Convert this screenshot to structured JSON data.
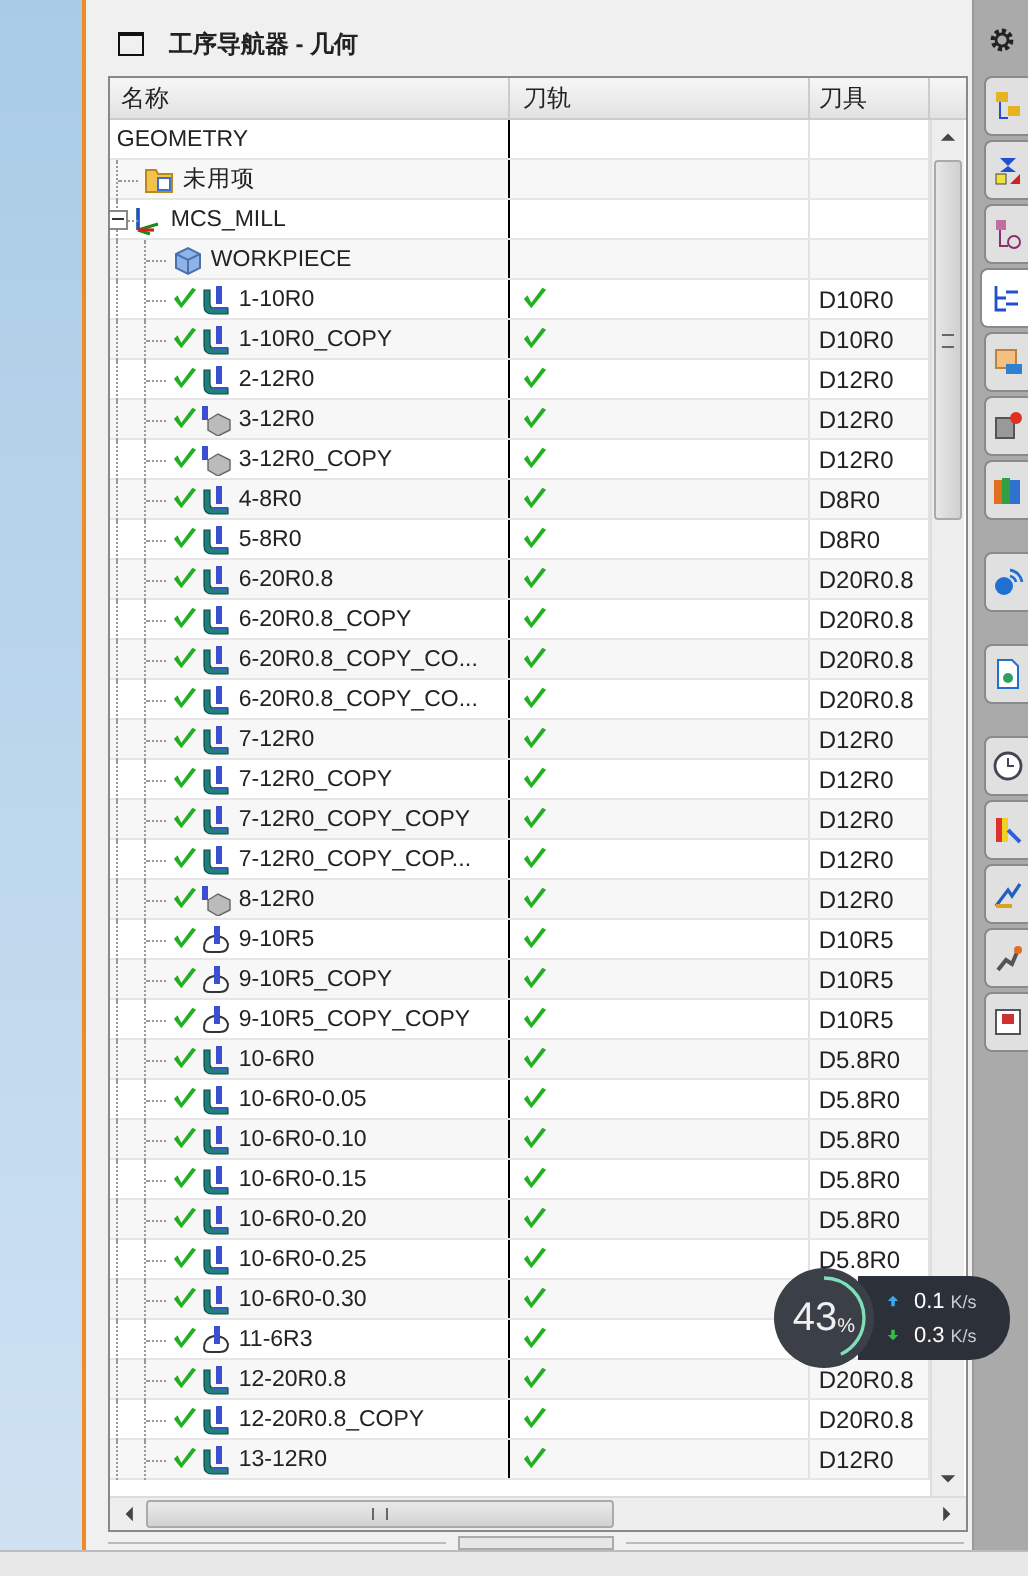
{
  "navigator": {
    "title": "工序导航器 - 几何",
    "columns": [
      "名称",
      "刀轨",
      "刀具"
    ],
    "tree": {
      "name": "GEOMETRY",
      "children": [
        {
          "name": "未用项",
          "kind": "folder"
        },
        {
          "name": "MCS_MILL",
          "kind": "mcs",
          "expanded": true,
          "children": [
            {
              "name": "WORKPIECE",
              "kind": "workpiece"
            },
            {
              "name": "1-10R0",
              "kind": "mill",
              "generated": true,
              "tool": "D10R0"
            },
            {
              "name": "1-10R0_COPY",
              "kind": "mill",
              "generated": true,
              "tool": "D10R0"
            },
            {
              "name": "2-12R0",
              "kind": "mill",
              "generated": true,
              "tool": "D12R0"
            },
            {
              "name": "3-12R0",
              "kind": "drill",
              "generated": true,
              "tool": "D12R0"
            },
            {
              "name": "3-12R0_COPY",
              "kind": "drill",
              "generated": true,
              "tool": "D12R0"
            },
            {
              "name": "4-8R0",
              "kind": "mill",
              "generated": true,
              "tool": "D8R0"
            },
            {
              "name": "5-8R0",
              "kind": "mill",
              "generated": true,
              "tool": "D8R0"
            },
            {
              "name": "6-20R0.8",
              "kind": "mill",
              "generated": true,
              "tool": "D20R0.8"
            },
            {
              "name": "6-20R0.8_COPY",
              "kind": "mill",
              "generated": true,
              "tool": "D20R0.8"
            },
            {
              "name": "6-20R0.8_COPY_CO...",
              "kind": "mill",
              "generated": true,
              "tool": "D20R0.8"
            },
            {
              "name": "6-20R0.8_COPY_CO...",
              "kind": "mill",
              "generated": true,
              "tool": "D20R0.8"
            },
            {
              "name": "7-12R0",
              "kind": "mill",
              "generated": true,
              "tool": "D12R0"
            },
            {
              "name": "7-12R0_COPY",
              "kind": "mill",
              "generated": true,
              "tool": "D12R0"
            },
            {
              "name": "7-12R0_COPY_COPY",
              "kind": "mill",
              "generated": true,
              "tool": "D12R0"
            },
            {
              "name": "7-12R0_COPY_COP...",
              "kind": "mill",
              "generated": true,
              "tool": "D12R0"
            },
            {
              "name": "8-12R0",
              "kind": "drill",
              "generated": true,
              "tool": "D12R0"
            },
            {
              "name": "9-10R5",
              "kind": "contour",
              "generated": true,
              "tool": "D10R5"
            },
            {
              "name": "9-10R5_COPY",
              "kind": "contour",
              "generated": true,
              "tool": "D10R5"
            },
            {
              "name": "9-10R5_COPY_COPY",
              "kind": "contour",
              "generated": true,
              "tool": "D10R5"
            },
            {
              "name": "10-6R0",
              "kind": "mill",
              "generated": true,
              "tool": "D5.8R0"
            },
            {
              "name": "10-6R0-0.05",
              "kind": "mill",
              "generated": true,
              "tool": "D5.8R0"
            },
            {
              "name": "10-6R0-0.10",
              "kind": "mill",
              "generated": true,
              "tool": "D5.8R0"
            },
            {
              "name": "10-6R0-0.15",
              "kind": "mill",
              "generated": true,
              "tool": "D5.8R0"
            },
            {
              "name": "10-6R0-0.20",
              "kind": "mill",
              "generated": true,
              "tool": "D5.8R0"
            },
            {
              "name": "10-6R0-0.25",
              "kind": "mill",
              "generated": true,
              "tool": "D5.8R0"
            },
            {
              "name": "10-6R0-0.30",
              "kind": "mill",
              "generated": true
            },
            {
              "name": "11-6R3",
              "kind": "contour",
              "generated": true
            },
            {
              "name": "12-20R0.8",
              "kind": "mill",
              "generated": true,
              "tool": "D20R0.8"
            },
            {
              "name": "12-20R0.8_COPY",
              "kind": "mill",
              "generated": true,
              "tool": "D20R0.8"
            },
            {
              "name": "13-12R0",
              "kind": "mill",
              "generated": true,
              "tool": "D12R0"
            }
          ]
        }
      ]
    }
  },
  "resource_bar": {
    "tabs": [
      {
        "selected": false
      },
      {
        "selected": false
      },
      {
        "selected": false
      },
      {
        "selected": true
      },
      {
        "selected": false
      },
      {
        "selected": false
      },
      {
        "selected": false
      },
      {
        "selected": false
      },
      {
        "selected": false
      },
      {
        "selected": false
      },
      {
        "selected": false
      },
      {
        "selected": false
      },
      {
        "selected": false
      },
      {
        "selected": false
      }
    ]
  },
  "speed_widget": {
    "percent": "43",
    "percent_unit": "%",
    "level": 0.43,
    "upload": "0.1",
    "upload_unit": "K/s",
    "download": "0.3",
    "download_unit": "K/s"
  }
}
